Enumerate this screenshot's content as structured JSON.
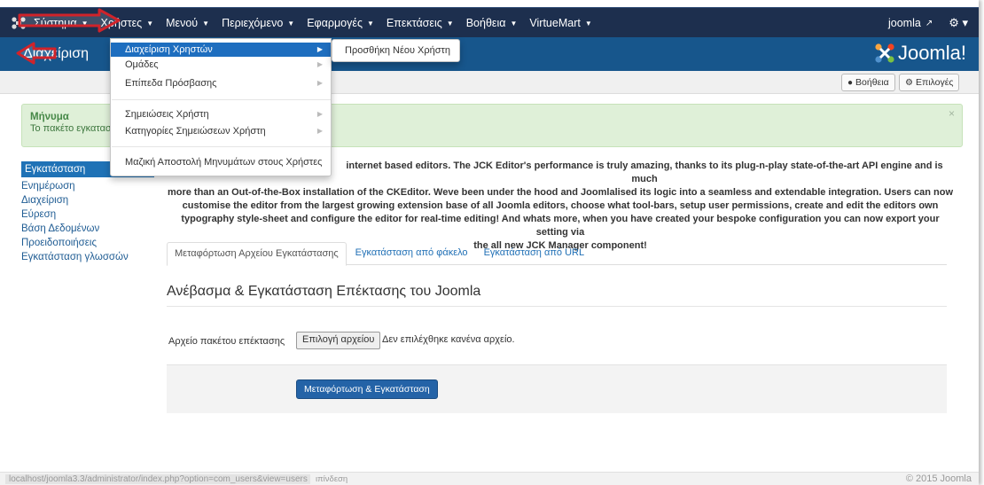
{
  "menu": {
    "items": [
      {
        "label": "Σύστημα"
      },
      {
        "label": "Χρήστες"
      },
      {
        "label": "Μενού"
      },
      {
        "label": "Περιεχόμενο"
      },
      {
        "label": "Εφαρμογές"
      },
      {
        "label": "Επεκτάσεις"
      },
      {
        "label": "Βοήθεια"
      },
      {
        "label": "VirtueMart"
      }
    ],
    "user": "joomla"
  },
  "header": {
    "page_title": "Διαχείριση",
    "brand": "Joomla!"
  },
  "toolbar": {
    "help_label": "Βοήθεια",
    "options_label": "Επιλογές"
  },
  "alert": {
    "heading": "Μήνυμα",
    "text": "Το πακέτο εγκατασ",
    "close": "×"
  },
  "sidebar": {
    "items": [
      {
        "label": "Εγκατάσταση"
      },
      {
        "label": "Ενημέρωση"
      },
      {
        "label": "Διαχείριση"
      },
      {
        "label": "Εύρεση"
      },
      {
        "label": "Βάση Δεδομένων"
      },
      {
        "label": "Προειδοποιήσεις"
      },
      {
        "label": "Εγκατάσταση γλωσσών"
      }
    ]
  },
  "description": {
    "line1": "internet based editors. The JCK Editor's performance is truly amazing, thanks to its plug-n-play state-of-the-art API engine and is much",
    "line2": "more than an Out-of-the-Box installation of the CKEditor. Weve been under the hood and Joomlalised its logic into a seamless and extendable integration. Users can now",
    "line3": "customise the editor from the largest growing extension base of all Joomla editors, choose what tool-bars, setup user permissions, create and edit the editors own",
    "line4": "typography style-sheet and configure the editor for real-time editing! And whats more, when you have created your bespoke configuration you can now export your setting via",
    "line5": "the all new JCK Manager component!"
  },
  "tabs": [
    {
      "label": "Μεταφόρτωση Αρχείου Εγκατάστασης"
    },
    {
      "label": "Εγκατάσταση από φάκελο"
    },
    {
      "label": "Εγκατάσταση από URL"
    }
  ],
  "upload": {
    "section_title": "Ανέβασμα & Εγκατάσταση Επέκτασης του Joomla",
    "field_label": "Αρχείο πακέτου επέκτασης",
    "file_button": "Επιλογή αρχείου",
    "file_status": "Δεν επιλέχθηκε κανένα αρχείο.",
    "submit_label": "Μεταφόρτωση & Εγκατάσταση"
  },
  "dropdown": {
    "items": [
      {
        "label": "Διαχείριση Χρηστών"
      },
      {
        "label": "Ομάδες"
      },
      {
        "label": "Επίπεδα Πρόσβασης"
      },
      {
        "label": "Σημειώσεις Χρήστη"
      },
      {
        "label": "Κατηγορίες Σημειώσεων Χρήστη"
      },
      {
        "label": "Μαζική Αποστολή Μηνυμάτων στους Χρήστες"
      }
    ],
    "submenu": "Προσθήκη Νέου Χρήστη"
  },
  "footer": {
    "url": "localhost/joomla3.3/administrator/index.php?option=com_users&view=users",
    "preview": "ιπίνδεση",
    "copyright": "© 2015 Joomla"
  },
  "colors": {
    "topbar": "#1d2f4e",
    "header": "#17568c",
    "accent": "#1e6ebf",
    "annotation": "#d0232a",
    "success_bg": "#dff0d8"
  },
  "icons": {
    "logo": "joomla-logo-icon",
    "external": "external-link-icon",
    "gear": "gear-icon",
    "help": "question-circle-icon",
    "options": "gear-icon"
  }
}
